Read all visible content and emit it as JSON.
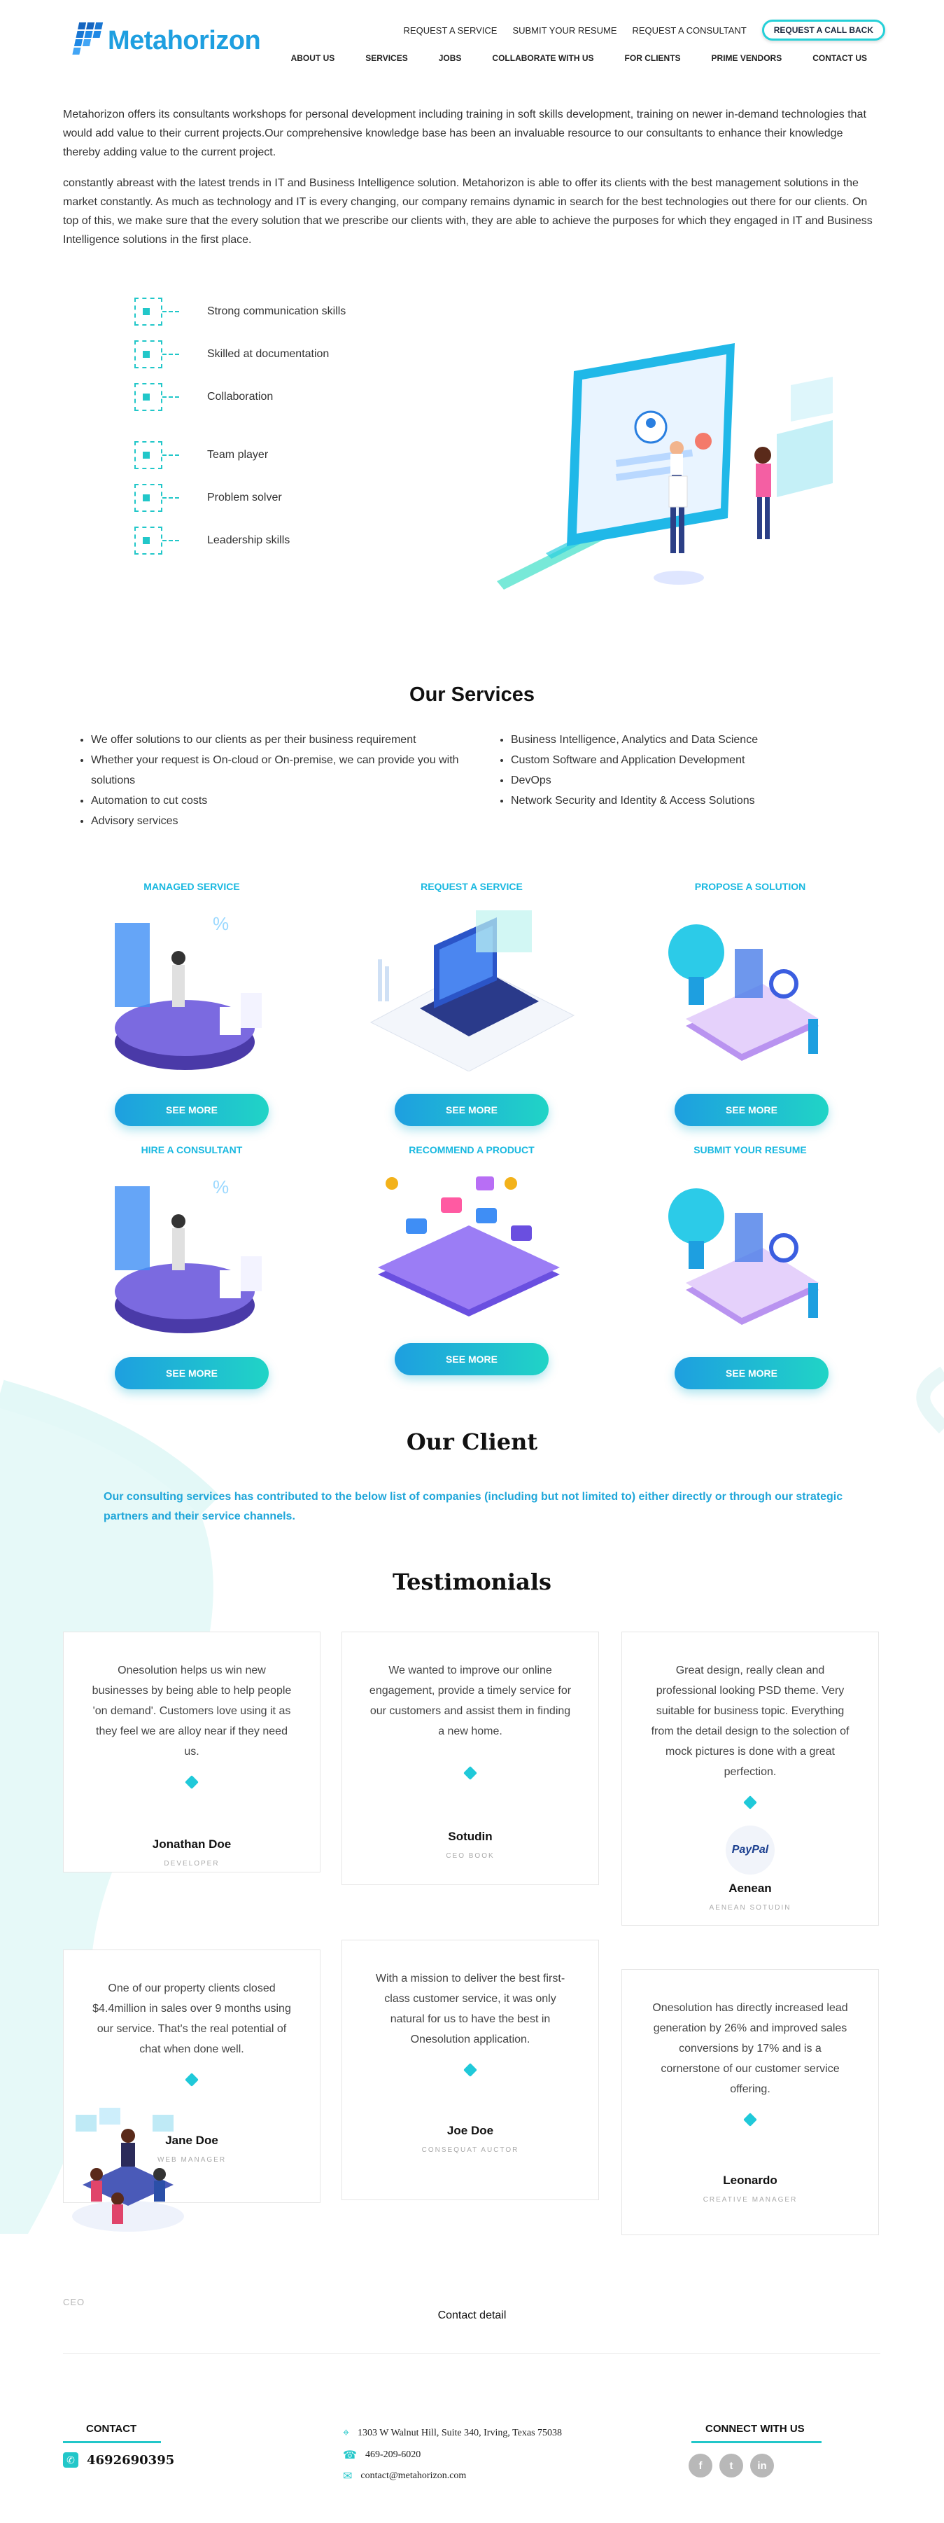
{
  "header": {
    "logo_text": "Metahorizon",
    "top_links": [
      "REQUEST A SERVICE",
      "SUBMIT YOUR RESUME",
      "REQUEST A CONSULTANT"
    ],
    "callback_label": "REQUEST A CALL BACK",
    "nav": [
      "ABOUT US",
      "SERVICES",
      "JOBS",
      "COLLABORATE WITH US",
      "FOR CLIENTS",
      "PRIME VENDORS",
      "CONTACT US"
    ]
  },
  "intro": {
    "p1": "Metahorizon offers its consultants workshops for personal development including training in soft skills development, training on newer in-demand technologies that would add value to their current projects.Our comprehensive knowledge base has been an invaluable resource to our consultants to enhance their knowledge thereby adding value to the current project.",
    "p2": "constantly abreast with the latest trends in IT and Business Intelligence solution. Metahorizon is able to offer its clients with the best management solutions in the market constantly. As much as technology and IT is every changing, our company remains dynamic in search for the best technologies out there for our clients. On top of this, we make sure that the every solution that we prescribe our clients with, they are able to achieve the purposes for which they engaged in IT and Business Intelligence solutions in the first place."
  },
  "skills": [
    "Strong communication skills",
    "Skilled at documentation",
    "Collaboration",
    "Team player",
    "Problem solver",
    "Leadership skills"
  ],
  "services": {
    "title": "Our Services",
    "left": [
      "We offer solutions to our clients as per their business requirement",
      "Whether your request is On-cloud or On-premise, we can provide you with solutions",
      "Automation to cut costs",
      "Advisory services"
    ],
    "right": [
      "Business Intelligence, Analytics and Data Science",
      "Custom Software and Application Development",
      "DevOps",
      "Network Security and Identity & Access Solutions"
    ],
    "cards": [
      {
        "title": "MANAGED SERVICE",
        "button": "SEE MORE"
      },
      {
        "title": "REQUEST A SERVICE",
        "button": "SEE MORE"
      },
      {
        "title": "PROPOSE A SOLUTION",
        "button": "SEE MORE"
      },
      {
        "title": "HIRE A CONSULTANT",
        "button": "SEE MORE"
      },
      {
        "title": "RECOMMEND A PRODUCT",
        "button": "SEE MORE"
      },
      {
        "title": "SUBMIT YOUR RESUME",
        "button": "SEE MORE"
      }
    ]
  },
  "client": {
    "title": "Our Client",
    "text": "Our consulting services has contributed to the below list of companies (including but not limited to) either directly or through our strategic partners and their service channels."
  },
  "testimonials": {
    "title": "Testimonials",
    "items": [
      {
        "quote": "Onesolution helps us win new businesses by being able to help people 'on demand'. Customers love using it as they feel we are alloy near if they need us.",
        "name": "Jonathan Doe",
        "role": "DEVELOPER"
      },
      {
        "quote": "We wanted to improve our online engagement, provide a timely service for our customers and assist them in finding a new home.",
        "name": "Sotudin",
        "role": "CEO BOOK"
      },
      {
        "quote": "Great design, really clean and professional looking PSD theme. Very suitable for business topic. Everything from the detail design to the solection of mock pictures is done with a great perfection.",
        "name": "Aenean",
        "role": "AENEAN SOTUDIN",
        "logo": "PayPal"
      },
      {
        "quote": "One of our property clients closed $4.4million in sales over 9 months using our service. That's the real potential of chat when done well.",
        "name": "Jane Doe",
        "role": "WEB MANAGER"
      },
      {
        "quote": "With a mission to deliver the best first-class customer service, it was only natural for us to have the best in Onesolution application.",
        "name": "Joe Doe",
        "role": "CONSEQUAT AUCTOR"
      },
      {
        "quote": "Onesolution has directly increased lead generation by 26% and improved sales conversions by 17% and is a cornerstone of our customer service offering.",
        "name": "Leonardo",
        "role": "CREATIVE MANAGER"
      }
    ]
  },
  "misc": {
    "ceo": "CEO",
    "contact_detail": "Contact detail"
  },
  "footer": {
    "contact_title": "CONTACT",
    "phone": "4692690395",
    "address": "1303 W Walnut Hill, Suite 340, Irving, Texas 75038",
    "tel": "469-209-6020",
    "email": "contact@metahorizon.com",
    "connect_title": "CONNECT WITH US",
    "social": [
      "facebook-icon",
      "twitter-icon",
      "linkedin-icon"
    ]
  },
  "colors": {
    "brand": "#1e9fe0",
    "accent": "#22c7c9"
  }
}
